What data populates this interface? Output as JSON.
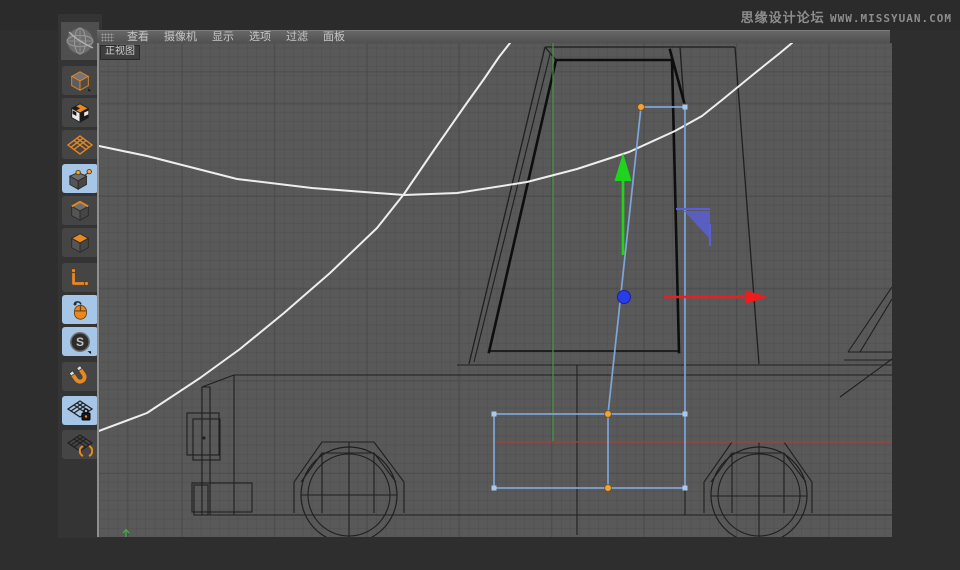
{
  "window": {
    "watermark_cn": "思缘设计论坛",
    "watermark_en": "WWW.MISSYUAN.COM"
  },
  "menu": {
    "items": [
      {
        "label": "查看"
      },
      {
        "label": "摄像机"
      },
      {
        "label": "显示"
      },
      {
        "label": "选项"
      },
      {
        "label": "过滤"
      },
      {
        "label": "面板"
      }
    ]
  },
  "viewport": {
    "label": "正视图",
    "view_type": "front-orthographic"
  },
  "toolbar": {
    "s_glyph": "S",
    "items": [
      {
        "name": "model-mode",
        "icon": "cube-outline-icon",
        "selected": false
      },
      {
        "name": "texture-mode",
        "icon": "checker-cube-icon",
        "selected": false
      },
      {
        "name": "workplane-mode",
        "icon": "grid-plane-icon",
        "selected": false
      },
      {
        "name": "points-mode",
        "icon": "points-cube-icon",
        "selected": true
      },
      {
        "name": "edges-mode",
        "icon": "edge-cube-icon",
        "selected": false
      },
      {
        "name": "polygons-mode",
        "icon": "polygon-cube-icon",
        "selected": false
      },
      {
        "name": "enable-axis-mode",
        "icon": "axis-icon",
        "selected": false
      },
      {
        "name": "viewport-tweak-mode",
        "icon": "mouse-icon",
        "selected": true
      },
      {
        "name": "snap-settings",
        "icon": "s-badge-icon",
        "selected": true
      },
      {
        "name": "magnet-snap",
        "icon": "magnet-icon",
        "selected": false
      },
      {
        "name": "workplane-lock",
        "icon": "grid-lock-icon",
        "selected": true
      },
      {
        "name": "workplane-interactive",
        "icon": "grid-rotate-icon",
        "selected": false
      }
    ]
  },
  "colors": {
    "frame": "#2e2e2e",
    "menubar": "#585858",
    "viewport_bg": "#595959",
    "grid_major": "#4c4c4c",
    "wire": "#1f1f1f",
    "wire_thick": "#0e0e0e",
    "spline_white": "#eeeeee",
    "select_blue": "#7da6d9",
    "handle_blue": "#a9c8ea",
    "point_orange": "#f0a438",
    "axis_green": "#3f9c3f",
    "axis_red": "#a83e34",
    "gizmo_green": "#1fd41f",
    "gizmo_red": "#ee1c1c",
    "gizmo_blue": "#2a3ce8",
    "plane_handle": "#5a5fd8",
    "accent_orange": "#e8881e",
    "hl_cell": "#a6c6e8",
    "text": "#c6c6c6",
    "watermark": "#8d8d8d"
  }
}
